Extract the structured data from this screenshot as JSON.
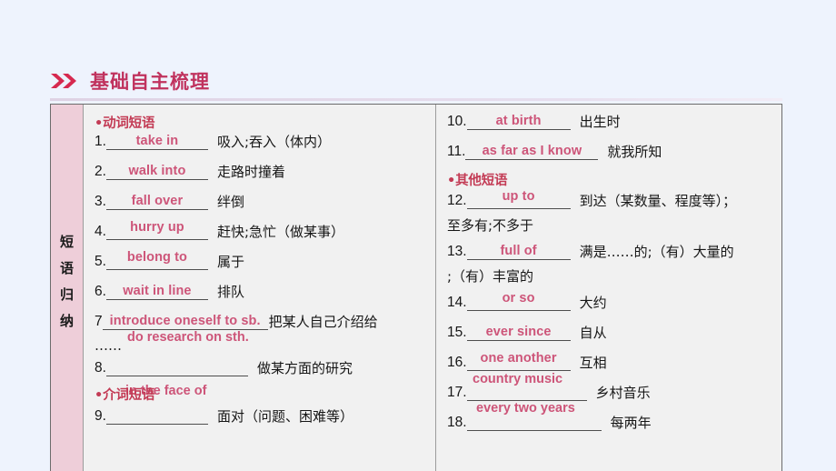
{
  "heading": {
    "text": "基础自主梳理",
    "accent_color": "#c0325e",
    "chevron_icon": "double-chevron-right-icon"
  },
  "table": {
    "row_label": [
      "短",
      "语",
      "归",
      "纳"
    ],
    "left_column": {
      "category_1": "•动词短语",
      "category_2": "•介词短语",
      "items": [
        {
          "num": "1.",
          "answer": "take in",
          "meaning": "吸入;吞入（体内）"
        },
        {
          "num": "2.",
          "answer": "walk into",
          "meaning": "走路时撞着"
        },
        {
          "num": "3.",
          "answer": "fall over",
          "meaning": "绊倒"
        },
        {
          "num": "4.",
          "answer": "hurry up",
          "meaning": "赶快;急忙（做某事）"
        },
        {
          "num": "5.",
          "answer": "belong to",
          "meaning": "属于"
        },
        {
          "num": "6.",
          "answer": "wait in line",
          "meaning": "排队"
        },
        {
          "num": "7",
          "answer": "introduce oneself to sb.",
          "meaning": "把某人自己介绍给"
        },
        {
          "num": "8.",
          "answer": "do research on sth.",
          "meaning": "做某方面的研究"
        },
        {
          "num": "9.",
          "answer": "in the face of",
          "meaning": "面对（问题、困难等）"
        }
      ],
      "item7_continuation": "……"
    },
    "right_column": {
      "category_1": "•其他短语",
      "items": [
        {
          "num": "10.",
          "answer": "at birth",
          "meaning": "出生时"
        },
        {
          "num": "11.",
          "answer": "as far as I know",
          "meaning": "就我所知"
        },
        {
          "num": "12.",
          "answer": "up to",
          "meaning": "到达（某数量、程度等）；",
          "meaning_cont": "至多有;不多于"
        },
        {
          "num": "13.",
          "answer": "full of",
          "meaning": "满是……的;（有）大量的",
          "meaning_cont": ";（有）丰富的"
        },
        {
          "num": "14.",
          "answer": "or so",
          "meaning": "大约"
        },
        {
          "num": "15.",
          "answer": "ever since",
          "meaning": "自从"
        },
        {
          "num": "16.",
          "answer": "one another",
          "meaning": "互相"
        },
        {
          "num": "17.",
          "answer": "country music",
          "meaning": "乡村音乐"
        },
        {
          "num": "18.",
          "answer": "every two years",
          "meaning": "每两年"
        }
      ]
    }
  },
  "colors": {
    "page_background": "#eef3fd",
    "heading_accent": "#c0325e",
    "answer_text": "#cd5579",
    "category_text": "#c33b55",
    "label_cell_background": "#eeced9",
    "table_background": "#f1f1f1"
  }
}
